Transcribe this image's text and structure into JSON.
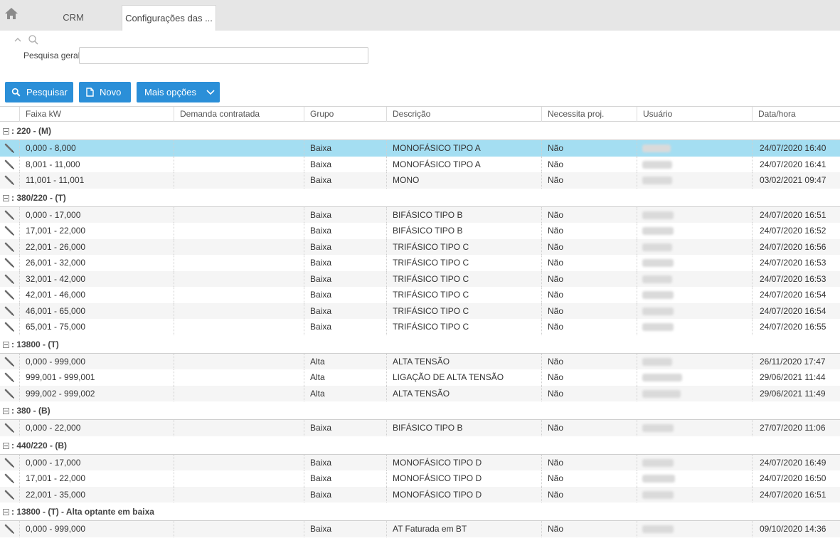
{
  "tabs": {
    "home_icon": "home-icon",
    "crm": "CRM",
    "active": "Configurações das ..."
  },
  "search": {
    "label": "Pesquisa geral",
    "value": "",
    "placeholder": ""
  },
  "toolbar": {
    "search_label": "Pesquisar",
    "new_label": "Novo",
    "more_label": "Mais opções",
    "accent": "#2b8fd8"
  },
  "columns": [
    "Faixa kW",
    "Demanda contratada",
    "Grupo",
    "Descrição",
    "Necessita proj.",
    "Usuário",
    "Data/hora"
  ],
  "selected_row_color": "#a4def2",
  "groups": [
    {
      "label": ": 220 - (M)",
      "rows": [
        {
          "faixa": "0,000 - 8,000",
          "demanda": "",
          "grupo": "Baixa",
          "descricao": "MONOFÁSICO TIPO A",
          "necessita": "Não",
          "data": "24/07/2020 16:40",
          "selected": true
        },
        {
          "faixa": "8,001 - 11,000",
          "demanda": "",
          "grupo": "Baixa",
          "descricao": "MONOFÁSICO TIPO A",
          "necessita": "Não",
          "data": "24/07/2020 16:41"
        },
        {
          "faixa": "11,001 - 11,001",
          "demanda": "",
          "grupo": "Baixa",
          "descricao": "MONO",
          "necessita": "Não",
          "data": "03/02/2021 09:47"
        }
      ]
    },
    {
      "label": ": 380/220 - (T)",
      "rows": [
        {
          "faixa": "0,000 - 17,000",
          "demanda": "",
          "grupo": "Baixa",
          "descricao": "BIFÁSICO TIPO B",
          "necessita": "Não",
          "data": "24/07/2020 16:51"
        },
        {
          "faixa": "17,001 - 22,000",
          "demanda": "",
          "grupo": "Baixa",
          "descricao": "BIFÁSICO TIPO B",
          "necessita": "Não",
          "data": "24/07/2020 16:52"
        },
        {
          "faixa": "22,001 - 26,000",
          "demanda": "",
          "grupo": "Baixa",
          "descricao": "TRIFÁSICO TIPO C",
          "necessita": "Não",
          "data": "24/07/2020 16:56"
        },
        {
          "faixa": "26,001 - 32,000",
          "demanda": "",
          "grupo": "Baixa",
          "descricao": "TRIFÁSICO TIPO C",
          "necessita": "Não",
          "data": "24/07/2020 16:53"
        },
        {
          "faixa": "32,001 - 42,000",
          "demanda": "",
          "grupo": "Baixa",
          "descricao": "TRIFÁSICO TIPO C",
          "necessita": "Não",
          "data": "24/07/2020 16:53"
        },
        {
          "faixa": "42,001 - 46,000",
          "demanda": "",
          "grupo": "Baixa",
          "descricao": "TRIFÁSICO TIPO C",
          "necessita": "Não",
          "data": "24/07/2020 16:54"
        },
        {
          "faixa": "46,001 - 65,000",
          "demanda": "",
          "grupo": "Baixa",
          "descricao": "TRIFÁSICO TIPO C",
          "necessita": "Não",
          "data": "24/07/2020 16:54"
        },
        {
          "faixa": "65,001 - 75,000",
          "demanda": "",
          "grupo": "Baixa",
          "descricao": "TRIFÁSICO TIPO C",
          "necessita": "Não",
          "data": "24/07/2020 16:55"
        }
      ]
    },
    {
      "label": ": 13800 - (T)",
      "rows": [
        {
          "faixa": "0,000 - 999,000",
          "demanda": "",
          "grupo": "Alta",
          "descricao": "ALTA TENSÃO",
          "necessita": "Não",
          "data": "26/11/2020 17:47"
        },
        {
          "faixa": "999,001 - 999,001",
          "demanda": "",
          "grupo": "Alta",
          "descricao": "LIGAÇÃO DE ALTA TENSÃO",
          "necessita": "Não",
          "data": "29/06/2021 11:44"
        },
        {
          "faixa": "999,002 - 999,002",
          "demanda": "",
          "grupo": "Alta",
          "descricao": "ALTA TENSÃO",
          "necessita": "Não",
          "data": "29/06/2021 11:49"
        }
      ]
    },
    {
      "label": ": 380 - (B)",
      "rows": [
        {
          "faixa": "0,000 - 22,000",
          "demanda": "",
          "grupo": "Baixa",
          "descricao": "BIFÁSICO TIPO B",
          "necessita": "Não",
          "data": "27/07/2020 11:06"
        }
      ]
    },
    {
      "label": ": 440/220 - (B)",
      "rows": [
        {
          "faixa": "0,000 - 17,000",
          "demanda": "",
          "grupo": "Baixa",
          "descricao": "MONOFÁSICO TIPO D",
          "necessita": "Não",
          "data": "24/07/2020 16:49"
        },
        {
          "faixa": "17,001 - 22,000",
          "demanda": "",
          "grupo": "Baixa",
          "descricao": "MONOFÁSICO TIPO D",
          "necessita": "Não",
          "data": "24/07/2020 16:50"
        },
        {
          "faixa": "22,001 - 35,000",
          "demanda": "",
          "grupo": "Baixa",
          "descricao": "MONOFÁSICO TIPO D",
          "necessita": "Não",
          "data": "24/07/2020 16:51"
        }
      ]
    },
    {
      "label": ": 13800 - (T) - Alta optante em baixa",
      "rows": [
        {
          "faixa": "0,000 - 999,000",
          "demanda": "",
          "grupo": "Baixa",
          "descricao": "AT Faturada em BT",
          "necessita": "Não",
          "data": "09/10/2020 14:36"
        }
      ]
    }
  ]
}
